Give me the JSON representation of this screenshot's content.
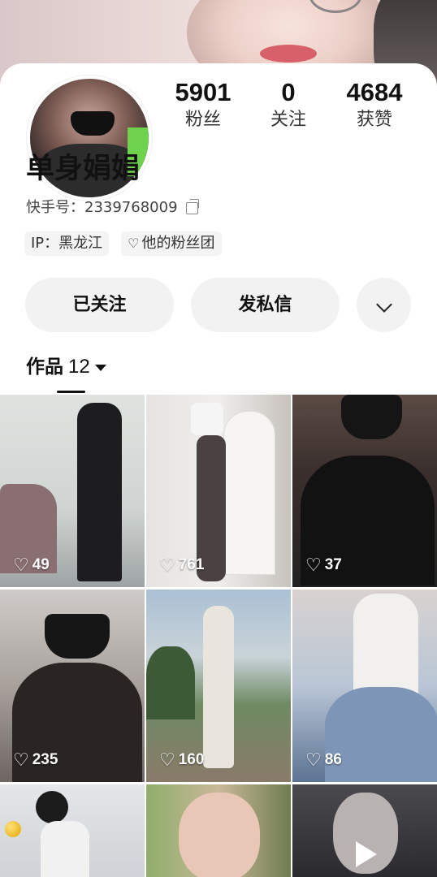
{
  "profile": {
    "nickname": "单身娟娟",
    "kuaishou_id": "快手号：2339768009",
    "ip_tag": "IP：黑龙江",
    "fan_group_tag": "他的粉丝团"
  },
  "stats": [
    {
      "value": "5901",
      "label": "粉丝"
    },
    {
      "value": "0",
      "label": "关注"
    },
    {
      "value": "4684",
      "label": "获赞"
    }
  ],
  "actions": {
    "follow_label": "已关注",
    "message_label": "发私信",
    "more_icon": "chevron-down-icon"
  },
  "tab": {
    "label": "作品",
    "count": "12"
  },
  "videos": [
    {
      "likes": "49"
    },
    {
      "likes": "761"
    },
    {
      "likes": "37"
    },
    {
      "likes": "235"
    },
    {
      "likes": "160"
    },
    {
      "likes": "86"
    },
    {
      "likes": ""
    },
    {
      "likes": ""
    },
    {
      "likes": ""
    }
  ],
  "colors": {
    "button_bg": "#f2f2f3",
    "tag_bg": "#f4f4f5",
    "text": "#111111"
  }
}
